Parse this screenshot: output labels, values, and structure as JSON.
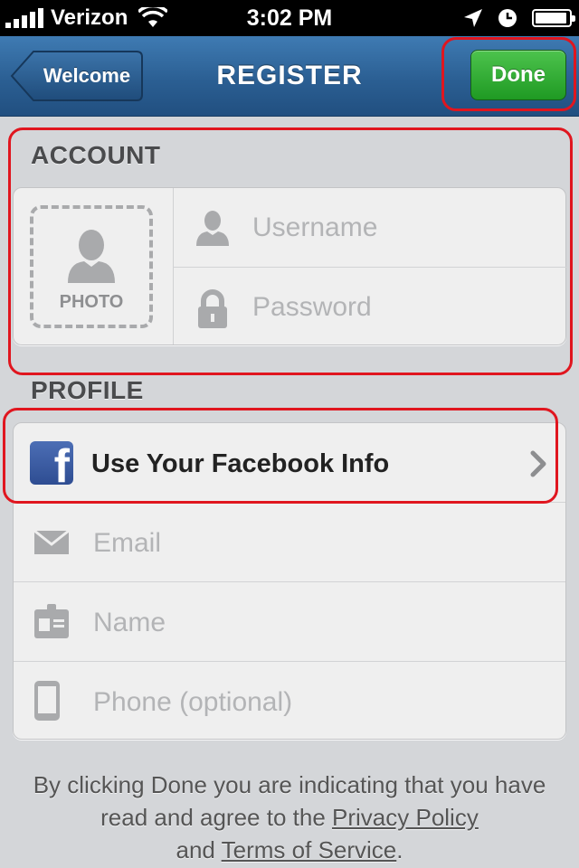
{
  "status_bar": {
    "carrier": "Verizon",
    "time": "3:02 PM",
    "battery_level": 0.95,
    "signal_bars": 5
  },
  "nav": {
    "back_label": "Welcome",
    "title": "REGISTER",
    "done_label": "Done"
  },
  "account": {
    "header": "ACCOUNT",
    "photo_label": "PHOTO",
    "username_placeholder": "Username",
    "password_placeholder": "Password"
  },
  "profile": {
    "header": "PROFILE",
    "facebook_label": "Use Your Facebook Info",
    "email_placeholder": "Email",
    "name_placeholder": "Name",
    "phone_placeholder": "Phone (optional)"
  },
  "footer": {
    "text_1": "By clicking Done you are indicating that you have read and agree to the",
    "privacy_link": "Privacy Policy",
    "and": "and",
    "terms_link": "Terms of Service",
    "period": "."
  },
  "colors": {
    "nav_blue": "#2b5f93",
    "done_green": "#1f9a23",
    "highlight_red": "#e0161f",
    "facebook_blue": "#3b5998"
  },
  "icons": {
    "signal": "signal-bars-icon",
    "wifi": "wifi-icon",
    "location": "location-arrow-icon",
    "clock": "clock-icon",
    "battery": "battery-icon",
    "person": "person-icon",
    "lock": "lock-icon",
    "facebook": "facebook-icon",
    "chevron": "chevron-right-icon",
    "email": "envelope-icon",
    "name": "id-card-icon",
    "phone": "phone-icon"
  }
}
